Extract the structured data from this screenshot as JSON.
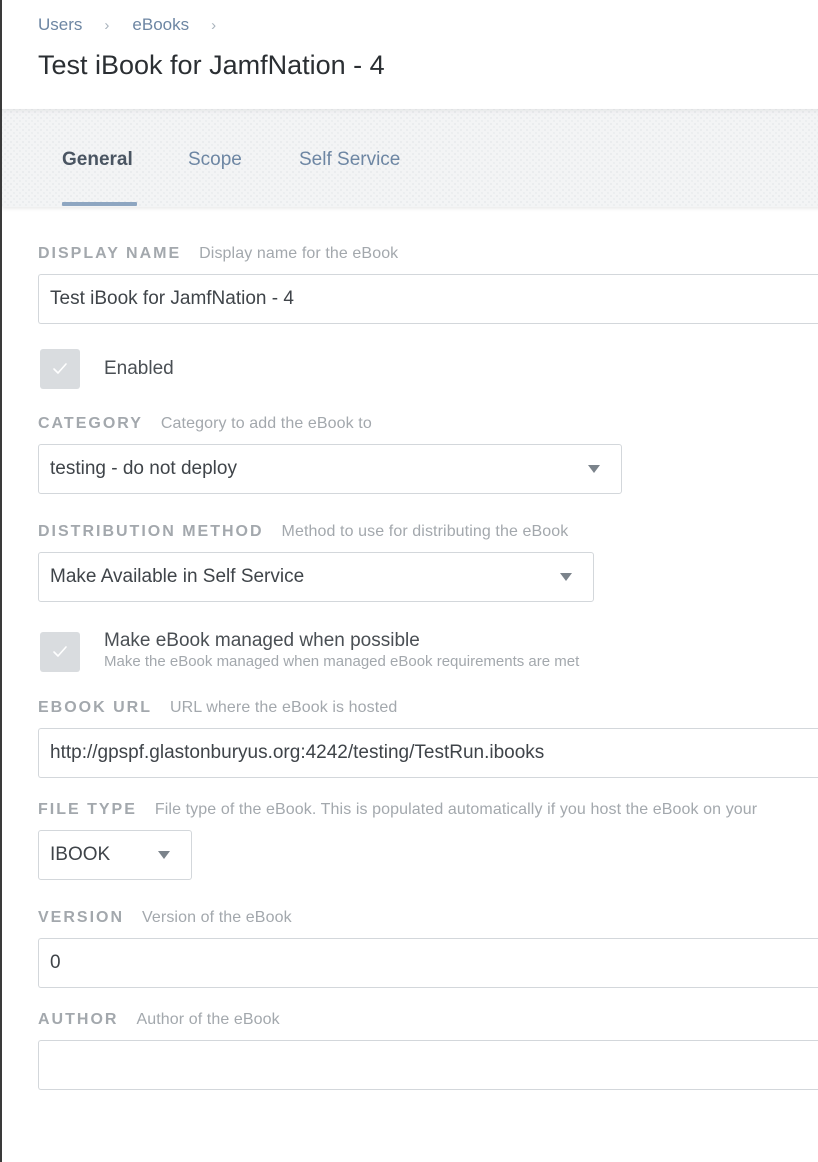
{
  "breadcrumb": {
    "items": [
      "Users",
      "eBooks"
    ],
    "separator": "›"
  },
  "page": {
    "title": "Test iBook for JamfNation - 4"
  },
  "tabs": [
    {
      "label": "General",
      "active": true
    },
    {
      "label": "Scope",
      "active": false
    },
    {
      "label": "Self Service",
      "active": false
    }
  ],
  "form": {
    "display_name": {
      "label": "DISPLAY NAME",
      "hint": "Display name for the eBook",
      "value": "Test iBook for JamfNation - 4"
    },
    "enabled": {
      "label": "Enabled",
      "checked": true
    },
    "category": {
      "label": "CATEGORY",
      "hint": "Category to add the eBook to",
      "value": "testing - do not deploy"
    },
    "distribution_method": {
      "label": "DISTRIBUTION METHOD",
      "hint": "Method to use for distributing the eBook",
      "value": "Make Available in Self Service"
    },
    "managed": {
      "label": "Make eBook managed when possible",
      "sublabel": "Make the eBook managed when managed eBook requirements are met",
      "checked": true
    },
    "ebook_url": {
      "label": "EBOOK URL",
      "hint": "URL where the eBook is hosted",
      "value": "http://gpspf.glastonburyus.org:4242/testing/TestRun.ibooks"
    },
    "file_type": {
      "label": "FILE TYPE",
      "hint": "File type of the eBook. This is populated automatically if you host the eBook on your",
      "value": "IBOOK"
    },
    "version": {
      "label": "VERSION",
      "hint": "Version of the eBook",
      "value": "0"
    },
    "author": {
      "label": "AUTHOR",
      "hint": "Author of the eBook",
      "value": ""
    }
  },
  "colors": {
    "link": "#6d86a3",
    "tab_underline": "#8ea6c1",
    "checkbox_bg": "#d9dcdf",
    "label_gray": "#a3a8ad"
  },
  "icons": {
    "checkbox_check": "check-icon",
    "dropdown": "caret-down-icon"
  }
}
